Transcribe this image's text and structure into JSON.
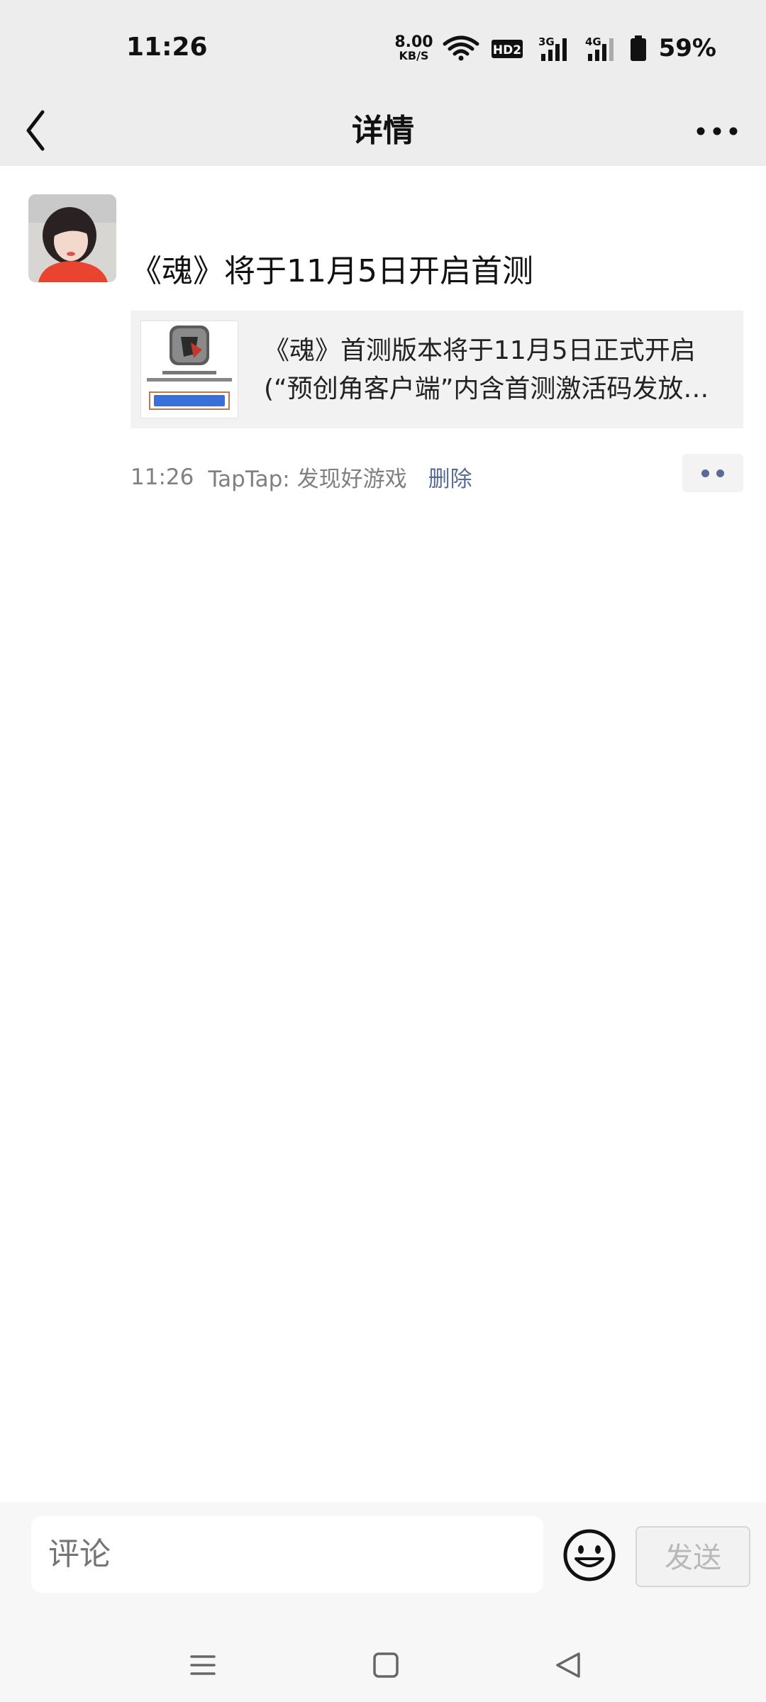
{
  "status_bar": {
    "time": "11:26",
    "net_speed_value": "8.00",
    "net_speed_unit": "KB/S",
    "hd_label": "HD2",
    "sim1_label": "3G",
    "sim2_label": "4G",
    "battery_pct": "59%"
  },
  "nav": {
    "title": "详情",
    "back_icon": "chevron-left-icon",
    "more_icon": "more-horizontal-icon"
  },
  "post": {
    "title": "《魂》将于11月5日开启首测",
    "card": {
      "line1": "《魂》首测版本将于11月5日正式开启",
      "line2": "(“预创角客户端”内含首测激活码发放…",
      "thumb_icon": "game-app-icon"
    },
    "time": "11:26",
    "source": "TapTap: 发现好游戏",
    "delete_label": "删除"
  },
  "comment_bar": {
    "placeholder": "评论",
    "send_label": "发送",
    "emoji_icon": "emoji-icon"
  },
  "colors": {
    "header_bg": "#ededed",
    "link_blue": "#576b95",
    "meta_gray": "#808080"
  }
}
